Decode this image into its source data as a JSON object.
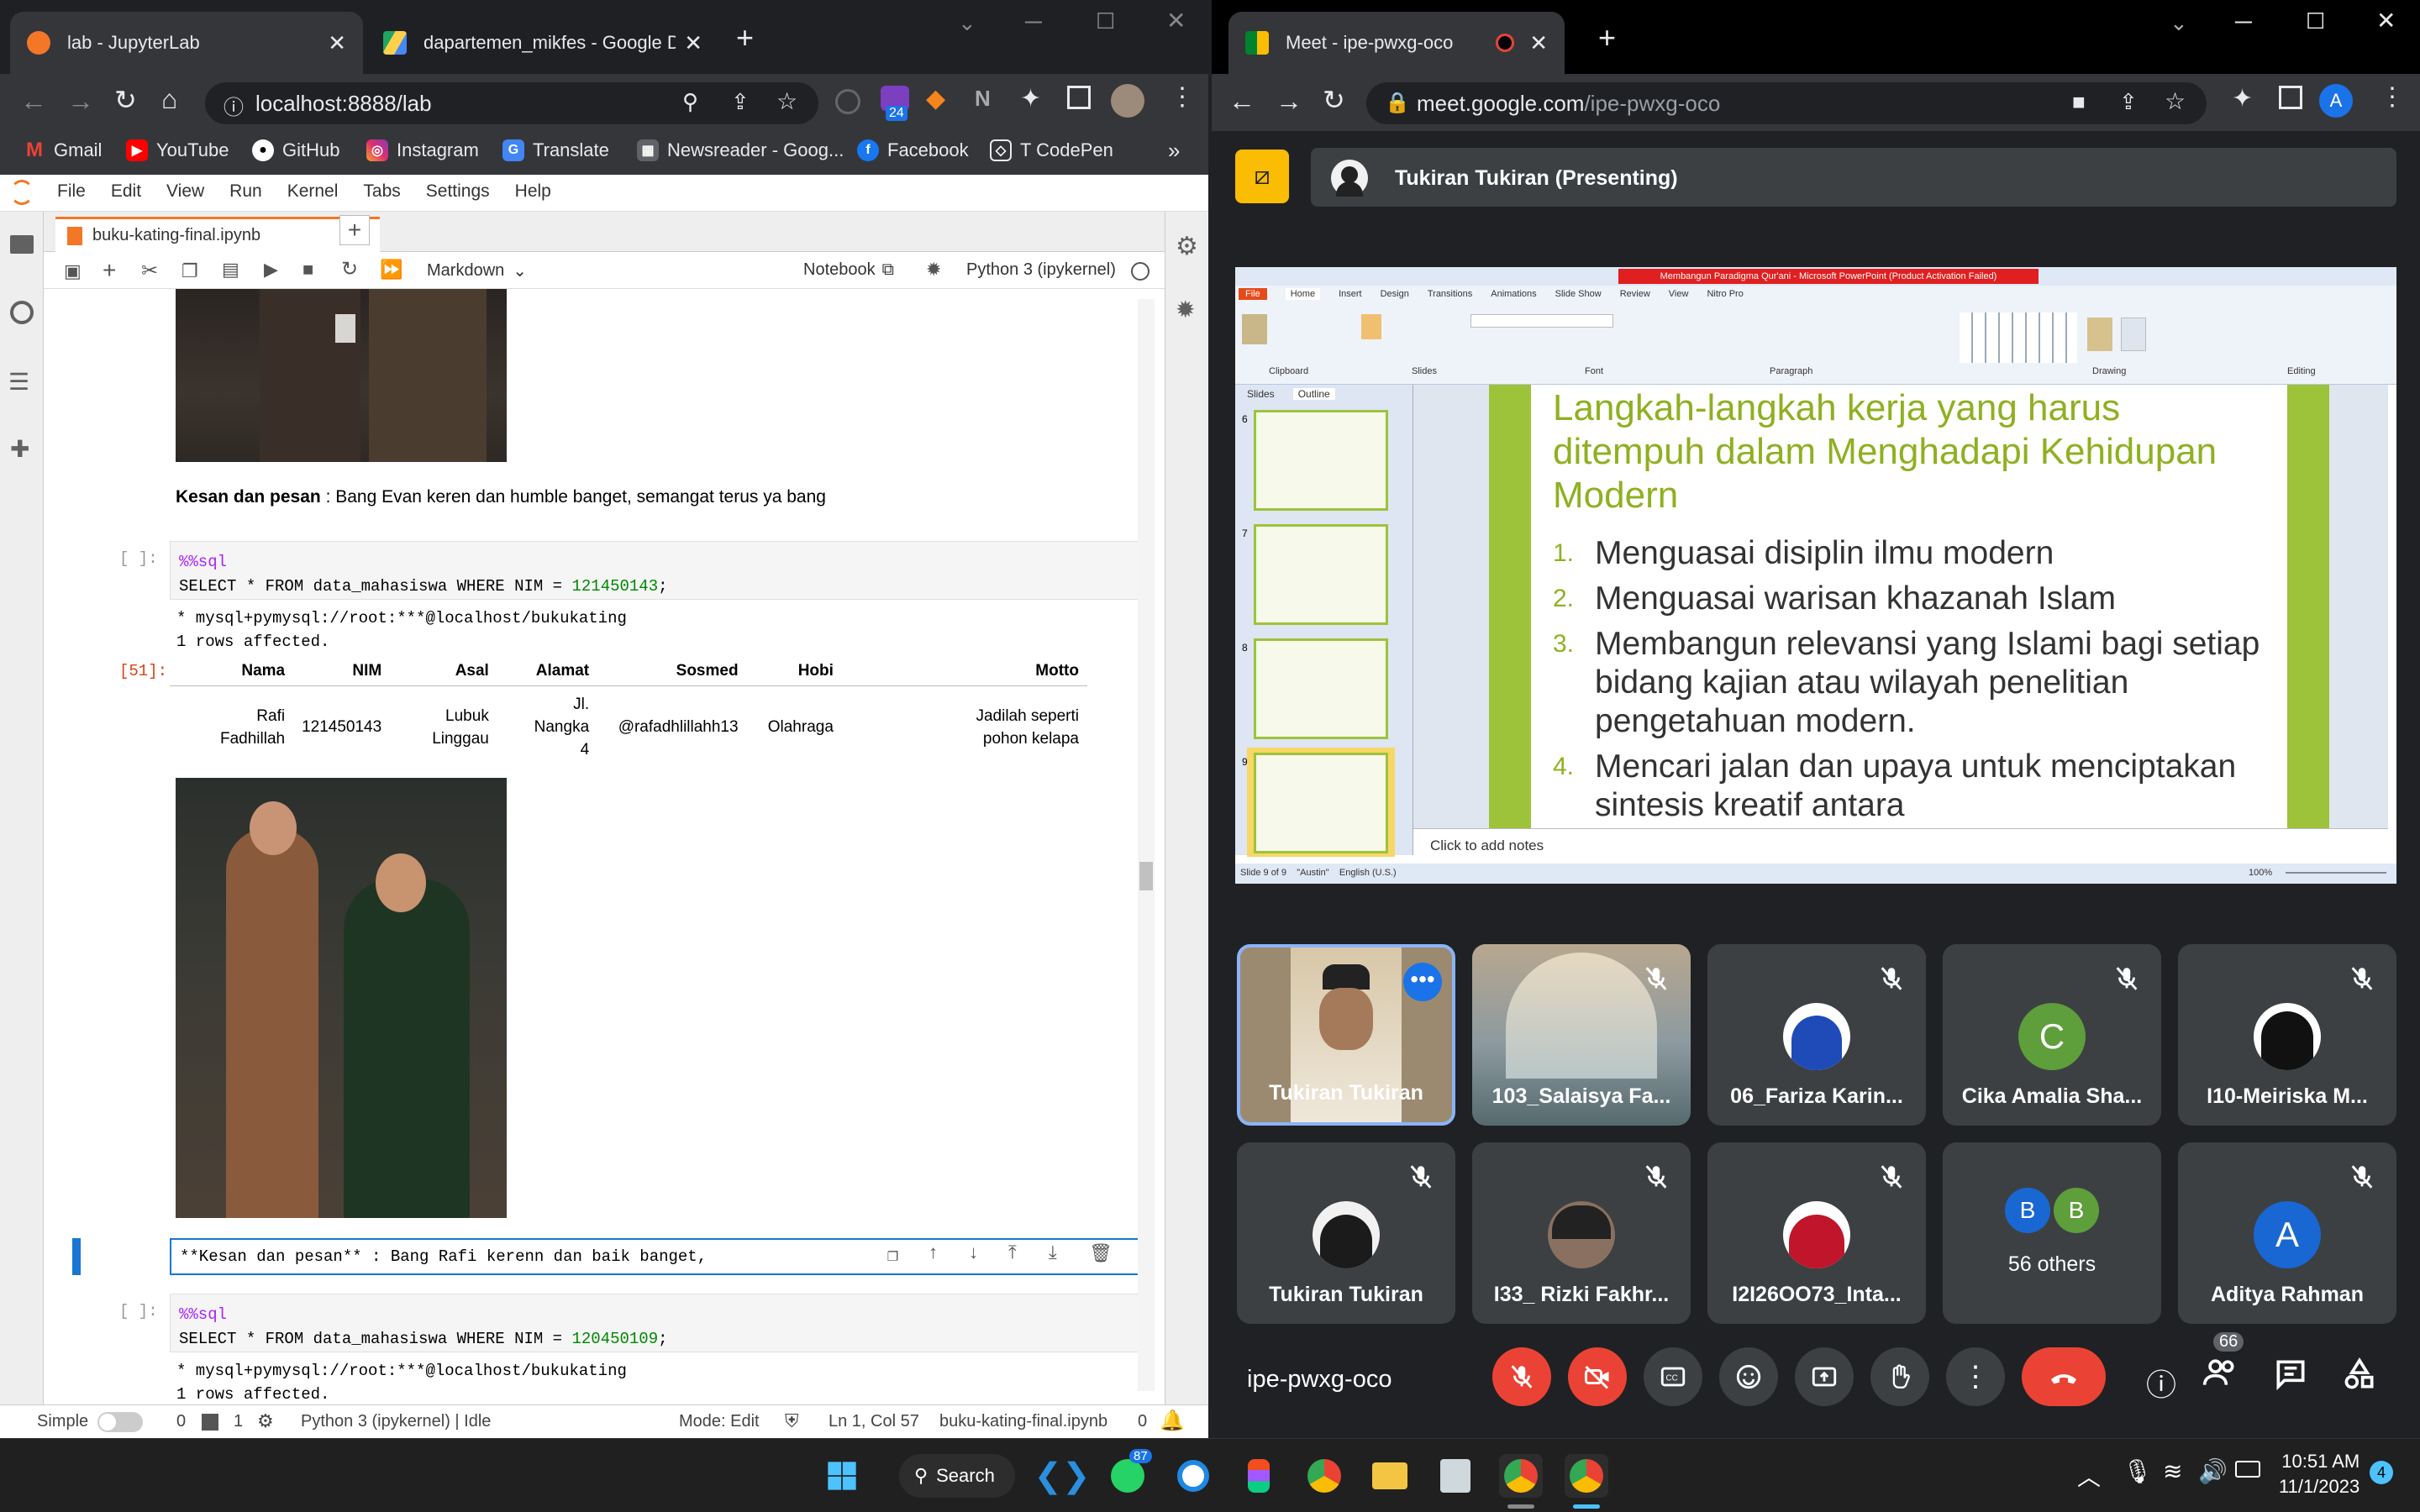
{
  "left_browser": {
    "tabs": [
      {
        "title": "lab - JupyterLab"
      },
      {
        "title": "dapartemen_mikfes - Google Dr"
      }
    ],
    "url": "localhost:8888/lab",
    "extension_badge": "24",
    "bookmarks": [
      "Gmail",
      "YouTube",
      "GitHub",
      "Instagram",
      "Translate",
      "Newsreader - Goog...",
      "Facebook",
      "T CodePen"
    ],
    "bookmarks_more": "»"
  },
  "jupyter": {
    "menu": [
      "File",
      "Edit",
      "View",
      "Run",
      "Kernel",
      "Tabs",
      "Settings",
      "Help"
    ],
    "notebook_tab": "buku-kating-final.ipynb",
    "cell_type": "Markdown",
    "notebook_label": "Notebook",
    "kernel": "Python 3 (ipykernel)",
    "cells": {
      "md1_bold": "Kesan dan pesan",
      "md1_text": " : Bang Evan keren dan humble banget, semangat terus ya bang",
      "prompt_empty": "[ ]:",
      "prompt_51": "[51]:",
      "code1_line1": "%%sql",
      "code1_line2_a": "SELECT * FROM data_mahasiswa WHERE NIM = ",
      "code1_nim": "121450143",
      "out_conn": " * mysql+pymysql://root:***@localhost/bukukating",
      "out_rows": "1 rows affected.",
      "table_headers": [
        "Nama",
        "NIM",
        "Asal",
        "Alamat",
        "Sosmed",
        "Hobi",
        "Motto"
      ],
      "table_row": [
        "Rafi Fadhillah",
        "121450143",
        "Lubuk Linggau",
        "Jl. Nangka 4",
        "@rafadhlillahh13",
        "Olahraga",
        "Jadilah seperti pohon kelapa"
      ],
      "edit_cell_text": "**Kesan dan pesan** : Bang Rafi kerenn dan baik banget,",
      "code2_line1": "%%sql",
      "code2_line2_a": "SELECT * FROM data_mahasiswa WHERE NIM = ",
      "code2_nim": "120450109",
      "out2_conn": " * mysql+pymysql://root:***@localhost/bukukating",
      "out2_rows": "1 rows affected."
    },
    "status": {
      "mode_simple": "Simple",
      "count0": "0",
      "count1": "1",
      "kernel_status": "Python 3 (ipykernel) | Idle",
      "mode": "Mode: Edit",
      "position": "Ln 1, Col 57",
      "file": "buku-kating-final.ipynb",
      "notif": "0"
    }
  },
  "right_browser": {
    "tab_title": "Meet - ipe-pwxg-oco",
    "url_bold": "meet.google.com",
    "url_rest": "/ipe-pwxg-oco",
    "profile_letter": "A"
  },
  "meet": {
    "presenter": "Tukiran Tukiran (Presenting)",
    "meeting_code": "ipe-pwxg-oco",
    "people_count": "66",
    "tiles": [
      {
        "name": "Tukiran Tukiran"
      },
      {
        "name": "103_Salaisya Fa..."
      },
      {
        "name": "06_Fariza Karin..."
      },
      {
        "name": "Cika Amalia Sha...",
        "letter": "C"
      },
      {
        "name": "I10-Meiriska M..."
      },
      {
        "name": "Tukiran Tukiran"
      },
      {
        "name": "I33_ Rizki Fakhr..."
      },
      {
        "name": "I2I26OO73_Inta..."
      },
      {
        "name": "56 others",
        "letters": [
          "B",
          "B"
        ]
      },
      {
        "name": "Aditya Rahman",
        "letter": "A"
      }
    ]
  },
  "slide": {
    "window_title": "Membangun Paradigma Qur'ani - Microsoft PowerPoint (Product Activation Failed)",
    "ribbon_tabs": [
      "File",
      "Home",
      "Insert",
      "Design",
      "Transitions",
      "Animations",
      "Slide Show",
      "Review",
      "View",
      "Nitro Pro"
    ],
    "ribbon_groups": [
      "Clipboard",
      "Slides",
      "Font",
      "Paragraph",
      "Drawing",
      "Editing"
    ],
    "panel_tabs": [
      "Slides",
      "Outline"
    ],
    "slide_numbers": [
      "6",
      "7",
      "8",
      "9"
    ],
    "heading": "Langkah-langkah kerja yang harus ditempuh  dalam Menghadapi Kehidupan Modern",
    "items": [
      {
        "n": "1.",
        "text": "Menguasai disiplin ilmu modern"
      },
      {
        "n": "2.",
        "text": "Menguasai warisan khazanah Islam"
      },
      {
        "n": "3.",
        "text": "Membangun relevansi yang Islami bagi setiap bidang kajian atau wilayah penelitian pengetahuan modern."
      },
      {
        "n": "4.",
        "text": "Mencari jalan dan upaya untuk menciptakan sintesis kreatif antara"
      }
    ],
    "notes": "Click to add notes",
    "status_left": "Slide 9 of 9    \"Austin\"    English (U.S.)",
    "zoom": "100%",
    "colors": {
      "heading": "#8fb021",
      "bar": "#9dc33b"
    }
  },
  "taskbar": {
    "search": "Search",
    "whatsapp_badge": "87",
    "time": "10:51 AM",
    "date": "11/1/2023",
    "notif": "4"
  }
}
